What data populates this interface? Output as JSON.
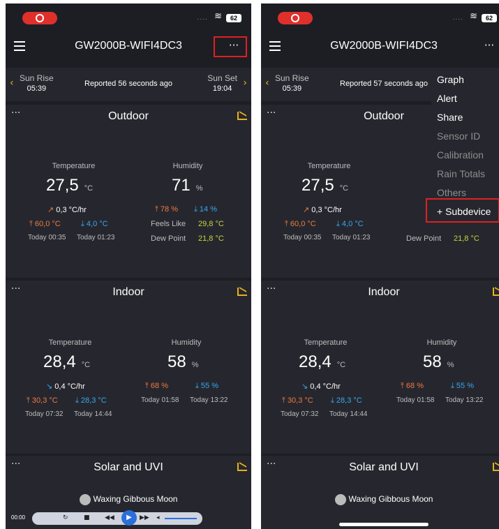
{
  "header": {
    "title": "GW2000B-WIFI4DC3",
    "more": "···"
  },
  "status": {
    "signal": "....",
    "battery": "62"
  },
  "sun": {
    "rise_label": "Sun Rise",
    "rise_time": "05:39",
    "set_label": "Sun Set",
    "set_time": "19:04",
    "reported_left": "Reported 56 seconds ago",
    "reported_right": "Reported 57 seconds ago"
  },
  "outdoor": {
    "title": "Outdoor",
    "temp_label": "Temperature",
    "temp": "27,5",
    "temp_unit": "°C",
    "hum_label": "Humidity",
    "hum": "71",
    "hum_unit": "%",
    "rate": "0,3 °C/hr",
    "tmax": "60,0 °C",
    "tmin": "4,0 °C",
    "tmax_time": "Today 00:35",
    "tmin_time": "Today 01:23",
    "hmax": "78 %",
    "hmin": "14 %",
    "feels_label": "Feels Like",
    "feels": "29,8 °C",
    "dew_label": "Dew Point",
    "dew": "21,8 °C"
  },
  "indoor": {
    "title": "Indoor",
    "temp_label": "Temperature",
    "temp": "28,4",
    "temp_unit": "°C",
    "hum_label": "Humidity",
    "hum": "58",
    "hum_unit": "%",
    "rate": "0,4 °C/hr",
    "tmax": "30,3 °C",
    "tmin": "28,3 °C",
    "tmax_time": "Today 07:32",
    "tmin_time": "Today 14:44",
    "hmax": "68 %",
    "hmin": "55 %",
    "hmax_time": "Today 01:58",
    "hmin_time": "Today 13:22"
  },
  "solar": {
    "title": "Solar and UVI",
    "moon": "Waxing Gibbous Moon"
  },
  "media": {
    "time": "00:00"
  },
  "menu": {
    "items": [
      {
        "label": "Graph",
        "enabled": true
      },
      {
        "label": "Alert",
        "enabled": true
      },
      {
        "label": "Share",
        "enabled": true
      },
      {
        "label": "Sensor ID",
        "enabled": false
      },
      {
        "label": "Calibration",
        "enabled": false
      },
      {
        "label": "Rain Totals",
        "enabled": false
      },
      {
        "label": "Others",
        "enabled": false
      },
      {
        "label": "+ Subdevice",
        "enabled": true
      }
    ]
  },
  "colors": {
    "accent": "#e7b21b",
    "highlight": "#e02020",
    "high": "#f07a40",
    "low": "#37a7f2",
    "yellow": "#c7d33b"
  }
}
